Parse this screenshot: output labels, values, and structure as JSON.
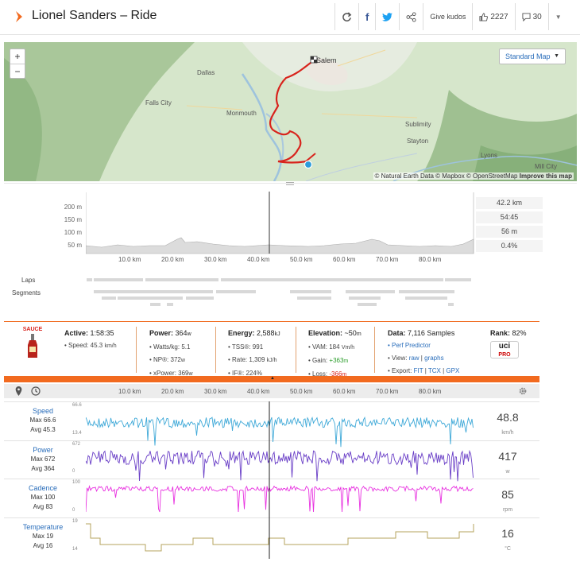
{
  "header": {
    "title": "Lionel Sanders – Ride",
    "give_kudos": "Give kudos",
    "kudos_count": "2227",
    "comment_count": "30"
  },
  "map": {
    "map_type": "Standard Map",
    "attribution": "© Natural Earth Data © Mapbox © OpenStreetMap",
    "attribution_link": "Improve this map",
    "towns": [
      "Salem",
      "Dallas",
      "Falls City",
      "Monmouth",
      "Sublimity",
      "Stayton",
      "Lyons",
      "Mill City"
    ]
  },
  "elevation": {
    "y_ticks": [
      "200 m",
      "150 m",
      "100 m",
      "50 m"
    ],
    "x_ticks": [
      "10.0 km",
      "20.0 km",
      "30.0 km",
      "40.0 km",
      "50.0 km",
      "60.0 km",
      "70.0 km",
      "80.0 km"
    ],
    "stats": [
      "42.2 km",
      "54:45",
      "56 m",
      "0.4%"
    ],
    "laps_label": "Laps",
    "segments_label": "Segments"
  },
  "sauce": {
    "label": "SAUCE",
    "active_label": "Active:",
    "active_value": "1:58:35",
    "speed_label": "• Speed:",
    "speed_value": "45.3",
    "speed_unit": "km/h",
    "power_label": "Power:",
    "power_value": "364",
    "power_unit": "w",
    "wkg_label": "• Watts/kg:",
    "wkg_value": "5.1",
    "np_label": "• NP®:",
    "np_value": "372",
    "np_unit": "w",
    "xpower_label": "• xPower:",
    "xpower_value": "369",
    "xpower_unit": "w",
    "energy_label": "Energy:",
    "energy_value": "2,588",
    "energy_unit": "kJ",
    "tss_label": "• TSS®:",
    "tss_value": "991",
    "rate_label": "• Rate:",
    "rate_value": "1,309",
    "rate_unit": "kJ/h",
    "if_label": "• IF®:",
    "if_value": "224%",
    "elev_label": "Elevation:",
    "elev_value": "~50",
    "elev_unit": "m",
    "vam_label": "• VAM:",
    "vam_value": "184",
    "vam_unit": "Vm/h",
    "gain_label": "• Gain:",
    "gain_value": "+363",
    "gain_unit": "m",
    "loss_label": "• Loss:",
    "loss_value": "-366",
    "loss_unit": "m",
    "data_label": "Data:",
    "data_value": "7,116 Samples",
    "perf_label": "• Perf Predictor",
    "view_label": "• View:",
    "view_raw": "raw",
    "view_graphs": "graphs",
    "export_label": "• Export:",
    "export_fit": "FIT",
    "export_tcx": "TCX",
    "export_gpx": "GPX",
    "rank_label": "Rank:",
    "rank_value": "82%",
    "uci_label": "uci",
    "uci_sub": "PRO"
  },
  "graphs": {
    "x_ticks": [
      "10.0 km",
      "20.0 km",
      "30.0 km",
      "40.0 km",
      "50.0 km",
      "60.0 km",
      "70.0 km",
      "80.0 km"
    ],
    "streams": [
      {
        "name": "Speed",
        "max_label": "Max 66.6",
        "avg_label": "Avg 45.3",
        "top": "66.6",
        "bottom": "13.4",
        "value": "48.8",
        "unit": "km/h",
        "color": "#3fa9d8"
      },
      {
        "name": "Power",
        "max_label": "Max 672",
        "avg_label": "Avg 364",
        "top": "672",
        "bottom": "0",
        "value": "417",
        "unit": "w",
        "color": "#6a3fc7"
      },
      {
        "name": "Cadence",
        "max_label": "Max 100",
        "avg_label": "Avg 83",
        "top": "100",
        "bottom": "0",
        "value": "85",
        "unit": "rpm",
        "color": "#e830e0"
      },
      {
        "name": "Temperature",
        "max_label": "Max 19",
        "avg_label": "Avg 16",
        "top": "19",
        "bottom": "14",
        "value": "16",
        "unit": "°C",
        "color": "#b4a35c"
      }
    ]
  },
  "colors": {
    "accent": "#f26a1f",
    "link": "#2a6ebb",
    "route": "#d8231c"
  }
}
